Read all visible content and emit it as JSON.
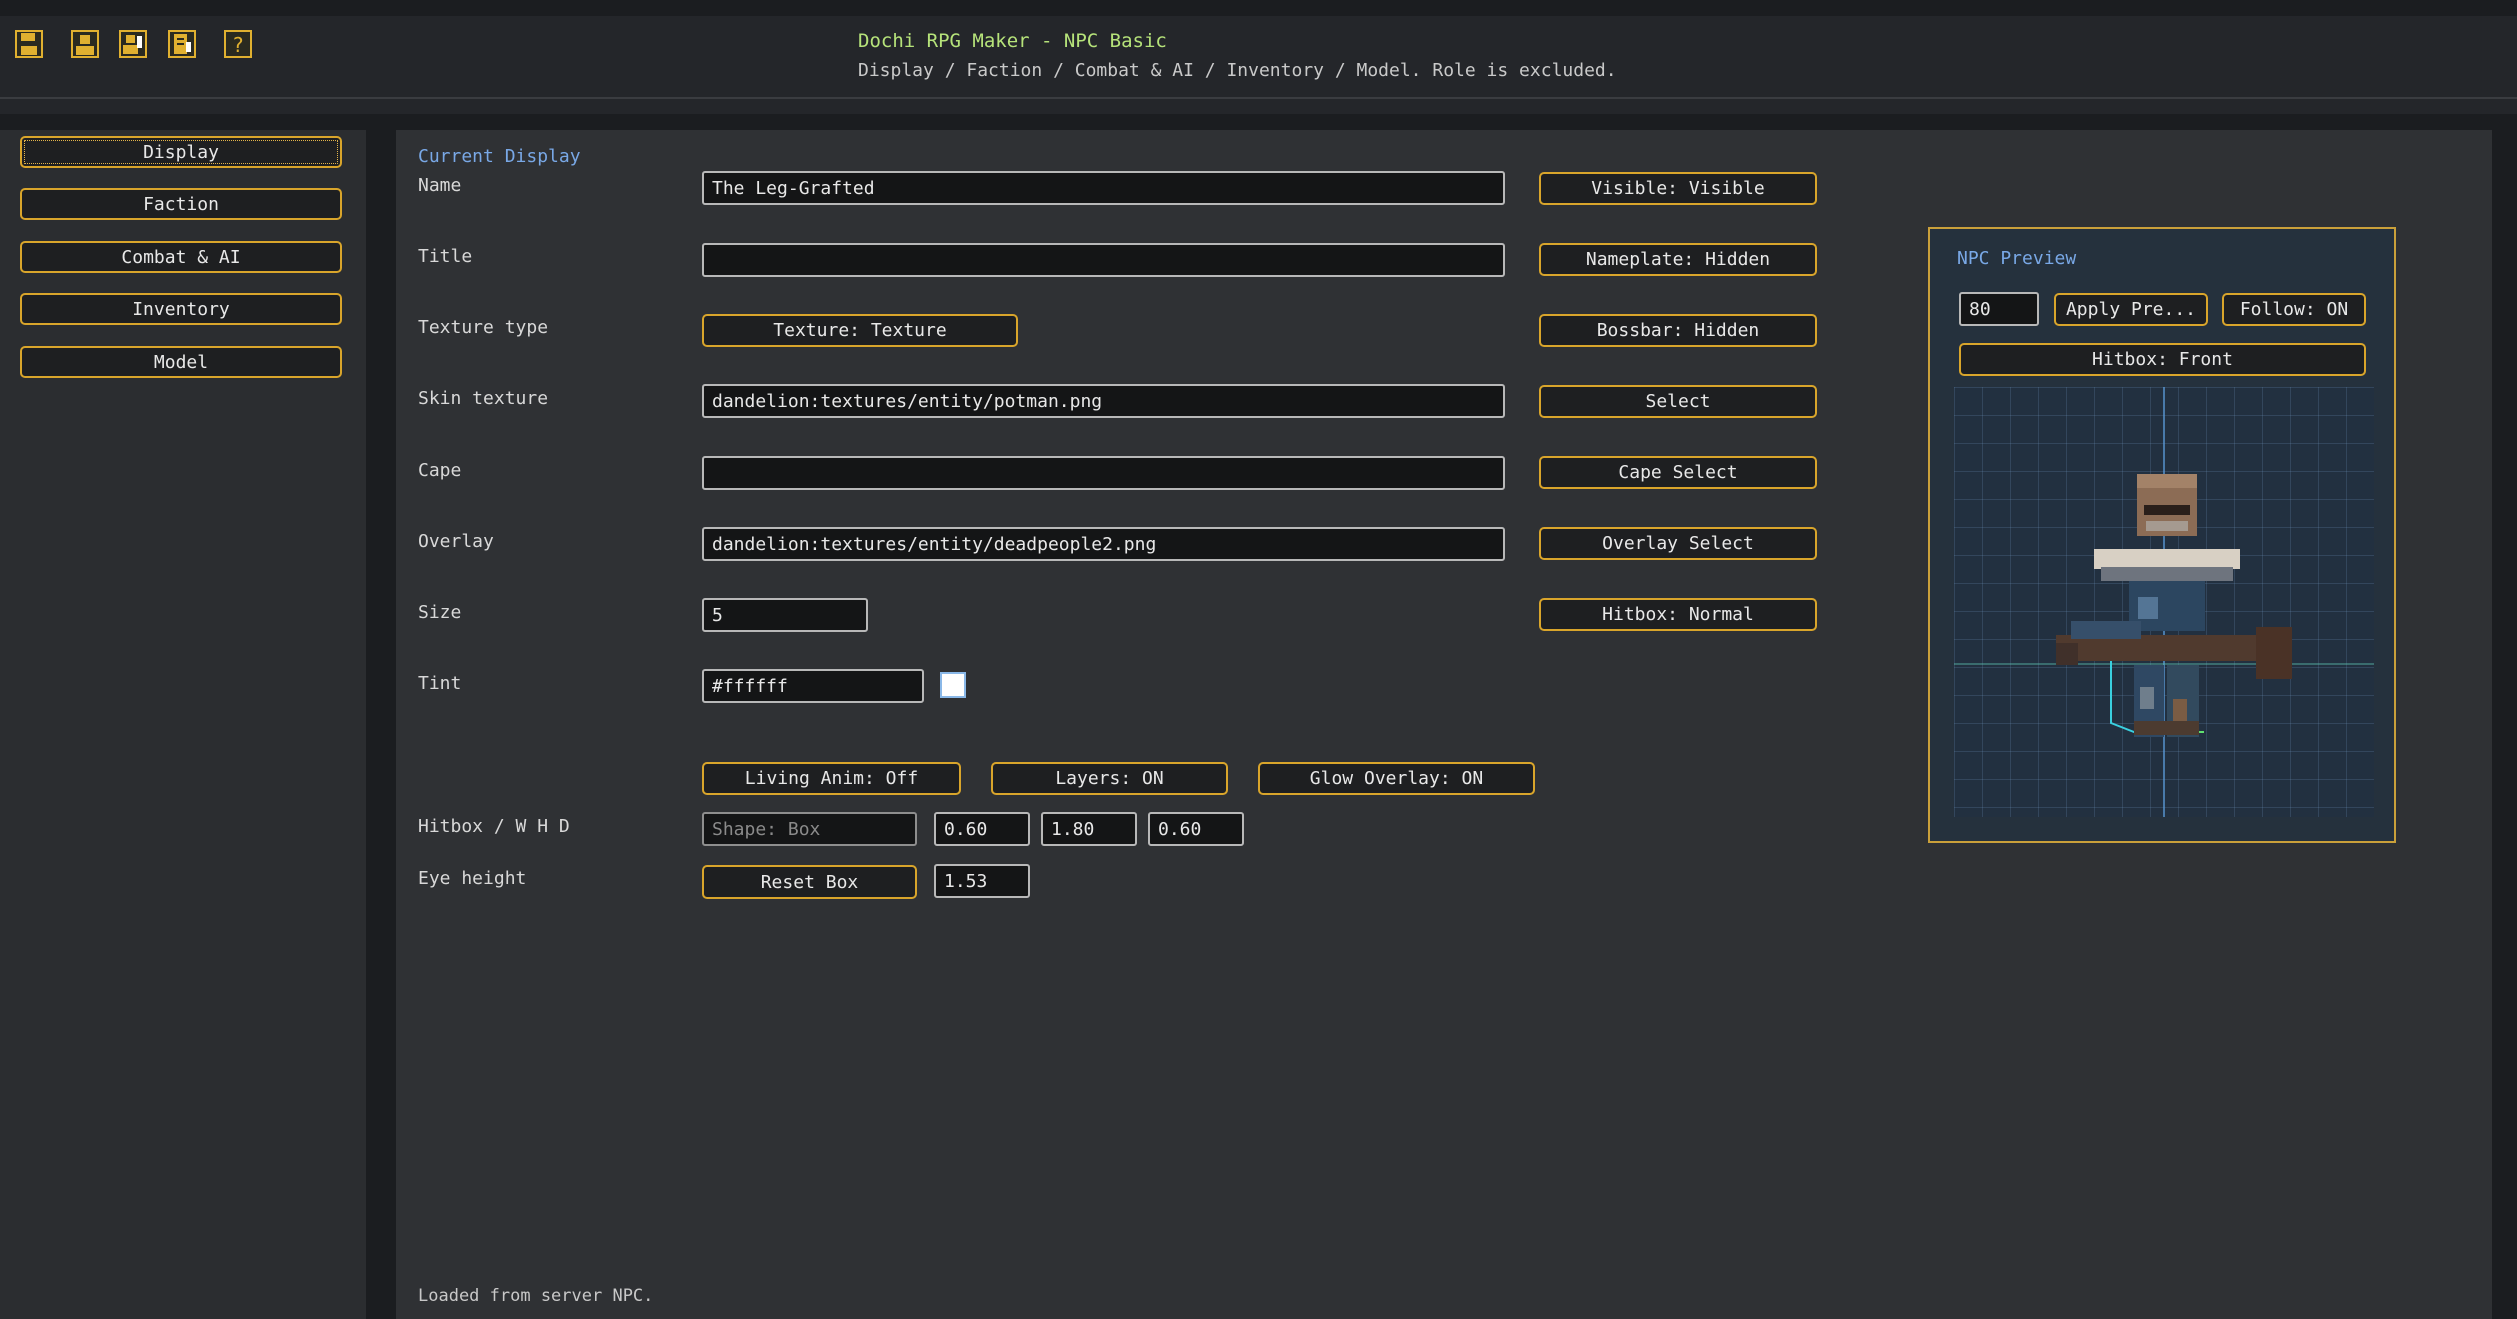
{
  "toolbar": {
    "icons": [
      "save-icon",
      "user-icon",
      "user-edit-icon",
      "document-edit-icon",
      "help-icon"
    ],
    "help_glyph": "?"
  },
  "header": {
    "title": "Dochi RPG Maker - NPC Basic",
    "subtitle": "Display / Faction / Combat & AI / Inventory / Model. Role is excluded."
  },
  "sidebar": {
    "items": [
      {
        "label": "Display",
        "active": true
      },
      {
        "label": "Faction",
        "active": false
      },
      {
        "label": "Combat & AI",
        "active": false
      },
      {
        "label": "Inventory",
        "active": false
      },
      {
        "label": "Model",
        "active": false
      }
    ]
  },
  "form": {
    "section_title": "Current Display",
    "name": {
      "label": "Name",
      "value": "The Leg-Grafted"
    },
    "title": {
      "label": "Title",
      "value": ""
    },
    "texture_type": {
      "label": "Texture type",
      "button": "Texture: Texture"
    },
    "skin_texture": {
      "label": "Skin texture",
      "value": "dandelion:textures/entity/potman.png"
    },
    "cape": {
      "label": "Cape",
      "value": ""
    },
    "overlay": {
      "label": "Overlay",
      "value": "dandelion:textures/entity/deadpeople2.png"
    },
    "size": {
      "label": "Size",
      "value": "5"
    },
    "tint": {
      "label": "Tint",
      "value": "#ffffff",
      "swatch_color": "#ffffff"
    },
    "toggles": {
      "living_anim": "Living Anim: Off",
      "layers": "Layers: ON",
      "glow_overlay": "Glow Overlay: ON"
    },
    "hitbox": {
      "label": "Hitbox / W H D",
      "shape_placeholder": "Shape: Box",
      "width": "0.60",
      "height": "1.80",
      "depth": "0.60"
    },
    "eye_height": {
      "label": "Eye height",
      "reset_button": "Reset Box",
      "value": "1.53"
    }
  },
  "side_buttons": {
    "visible": "Visible: Visible",
    "nameplate": "Nameplate: Hidden",
    "bossbar": "Bossbar: Hidden",
    "select": "Select",
    "cape_select": "Cape Select",
    "overlay_select": "Overlay Select",
    "hitbox_mode": "Hitbox: Normal"
  },
  "preview": {
    "title": "NPC Preview",
    "zoom_value": "80",
    "apply_button": "Apply Pre...",
    "follow_button": "Follow: ON",
    "hitbox_button": "Hitbox: Front"
  },
  "status": "Loaded from server NPC.",
  "colors": {
    "accent_border": "#d9a52b",
    "title_green": "#b6e37a",
    "section_blue": "#79a8e6"
  }
}
